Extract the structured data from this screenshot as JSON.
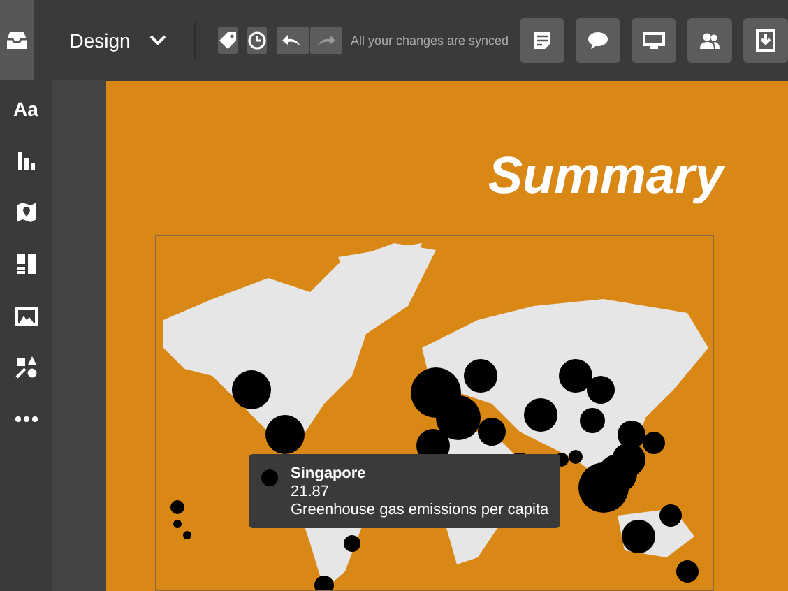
{
  "toolbar": {
    "mode": "Design",
    "sync_status": "All your changes are synced"
  },
  "sidebar": {
    "items": [
      {
        "kind": "text",
        "label": "Aa"
      },
      {
        "kind": "chart"
      },
      {
        "kind": "map"
      },
      {
        "kind": "layout"
      },
      {
        "kind": "image"
      },
      {
        "kind": "shapes"
      },
      {
        "kind": "more"
      }
    ]
  },
  "canvas": {
    "title": "Summary",
    "tooltip": {
      "name": "Singapore",
      "value": "21.87",
      "measure": "Greenhouse gas emissions per capita"
    }
  }
}
